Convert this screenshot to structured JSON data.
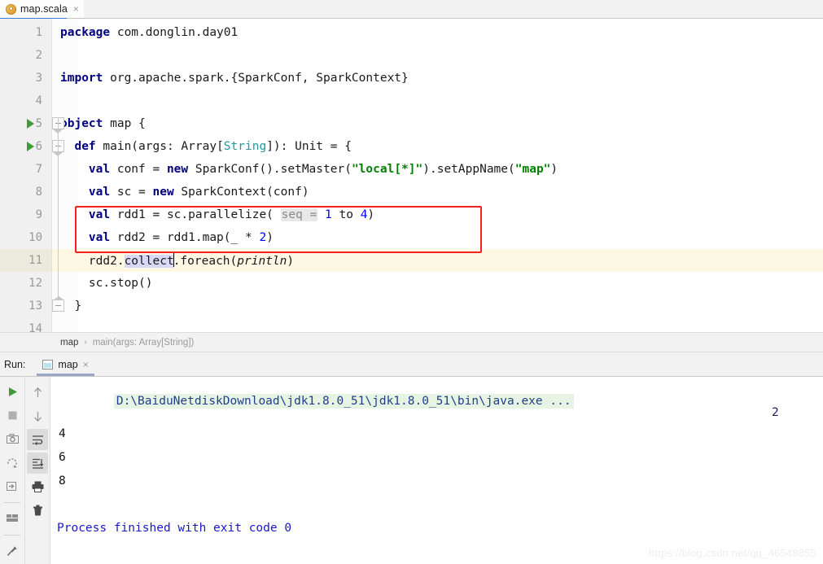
{
  "window": {
    "tab": {
      "filename": "map.scala",
      "icon": "scala-file-icon",
      "close": "×"
    }
  },
  "editor": {
    "lines": [
      {
        "n": "1",
        "segments": [
          {
            "t": "package ",
            "c": "kw"
          },
          {
            "t": "com.donglin.day01",
            "c": "plain"
          }
        ]
      },
      {
        "n": "2",
        "segments": []
      },
      {
        "n": "3",
        "segments": [
          {
            "t": "import ",
            "c": "kw"
          },
          {
            "t": "org.apache.spark.{SparkConf, SparkContext}",
            "c": "plain"
          }
        ]
      },
      {
        "n": "4",
        "segments": []
      },
      {
        "n": "5",
        "segments": [
          {
            "t": "object ",
            "c": "kw"
          },
          {
            "t": "map {",
            "c": "plain"
          }
        ]
      },
      {
        "n": "6",
        "segments": [
          {
            "t": "  def ",
            "c": "kw"
          },
          {
            "t": "main(args: Array[",
            "c": "plain"
          },
          {
            "t": "String",
            "c": "typ"
          },
          {
            "t": "]): Unit = {",
            "c": "plain"
          }
        ]
      },
      {
        "n": "7",
        "segments": [
          {
            "t": "    ",
            "c": "plain"
          },
          {
            "t": "val ",
            "c": "kw"
          },
          {
            "t": "conf = ",
            "c": "plain"
          },
          {
            "t": "new ",
            "c": "kw"
          },
          {
            "t": "SparkConf().setMaster(",
            "c": "plain"
          },
          {
            "t": "\"local[*]\"",
            "c": "str"
          },
          {
            "t": ").setAppName(",
            "c": "plain"
          },
          {
            "t": "\"map\"",
            "c": "str"
          },
          {
            "t": ")",
            "c": "plain"
          }
        ]
      },
      {
        "n": "8",
        "segments": [
          {
            "t": "    ",
            "c": "plain"
          },
          {
            "t": "val ",
            "c": "kw"
          },
          {
            "t": "sc = ",
            "c": "plain"
          },
          {
            "t": "new ",
            "c": "kw"
          },
          {
            "t": "SparkContext(conf)",
            "c": "plain"
          }
        ]
      },
      {
        "n": "9",
        "segments": [
          {
            "t": "    ",
            "c": "plain"
          },
          {
            "t": "val ",
            "c": "kw"
          },
          {
            "t": "rdd1 = sc.parallelize( ",
            "c": "plain"
          },
          {
            "t": "seq =",
            "c": "hint"
          },
          {
            "t": " ",
            "c": "plain"
          },
          {
            "t": "1",
            "c": "num"
          },
          {
            "t": " to ",
            "c": "plain"
          },
          {
            "t": "4",
            "c": "num"
          },
          {
            "t": ")",
            "c": "plain"
          }
        ]
      },
      {
        "n": "10",
        "segments": [
          {
            "t": "    ",
            "c": "plain"
          },
          {
            "t": "val ",
            "c": "kw"
          },
          {
            "t": "rdd2 = rdd1.map(_ * ",
            "c": "plain"
          },
          {
            "t": "2",
            "c": "num"
          },
          {
            "t": ")",
            "c": "plain"
          }
        ]
      },
      {
        "n": "11",
        "segments": [
          {
            "t": "    rdd2.",
            "c": "plain"
          },
          {
            "t": "collect",
            "c": "sel"
          },
          {
            "t": "",
            "c": "caret"
          },
          {
            "t": ".foreach(",
            "c": "plain"
          },
          {
            "t": "println",
            "c": "ital"
          },
          {
            "t": ")",
            "c": "plain"
          }
        ]
      },
      {
        "n": "12",
        "segments": [
          {
            "t": "    sc.stop()",
            "c": "plain"
          }
        ]
      },
      {
        "n": "13",
        "segments": [
          {
            "t": "  }",
            "c": "plain"
          }
        ]
      },
      {
        "n": "14",
        "segments": []
      }
    ],
    "current_line": "11",
    "run_arrow_lines": [
      "5",
      "6"
    ],
    "annotation": {
      "type": "red-rectangle",
      "color": "#fb1f1f",
      "covers_lines": [
        "9",
        "10"
      ]
    }
  },
  "breadcrumb": {
    "items": [
      "map",
      "main(args: Array[String])"
    ],
    "separator": "›"
  },
  "run_panel": {
    "label": "Run:",
    "tab": {
      "title": "map",
      "icon": "run-config-icon",
      "close": "×"
    },
    "left_toolbar": [
      {
        "name": "rerun-icon",
        "glyph": "▶"
      },
      {
        "name": "stop-icon",
        "glyph": "■"
      },
      {
        "name": "screenshot-icon",
        "glyph": "📷"
      },
      {
        "name": "rerun-failed-tests-icon",
        "glyph": "↻"
      },
      {
        "name": "dump-threads-icon",
        "glyph": "⇥"
      },
      {
        "name": "layout-settings-icon",
        "glyph": "▤"
      },
      {
        "name": "pin-tab-icon",
        "glyph": "📌"
      }
    ],
    "right_toolbar": [
      {
        "name": "up-arrow-icon",
        "glyph": "↑",
        "active": false
      },
      {
        "name": "down-arrow-icon",
        "glyph": "↓",
        "active": false
      },
      {
        "name": "soft-wrap-icon",
        "glyph": "↵",
        "active": true
      },
      {
        "name": "scroll-to-end-icon",
        "glyph": "↧",
        "active": true
      },
      {
        "name": "print-icon",
        "glyph": "🖨",
        "active": false
      },
      {
        "name": "clear-all-icon",
        "glyph": "🗑",
        "active": false
      }
    ],
    "console": {
      "command": "D:\\BaiduNetdiskDownload\\jdk1.8.0_51\\jdk1.8.0_51\\bin\\java.exe ...",
      "output": [
        "4",
        "6",
        "8"
      ],
      "right_value": "2",
      "finished": "Process finished with exit code 0"
    }
  },
  "watermark": "https://blog.csdn.net/qq_46548855",
  "colors": {
    "keyword": "#000080",
    "string": "#008000",
    "number": "#0000ff",
    "type": "#20999d",
    "annotation_red": "#fb1f1f",
    "tab_accent": "#3b7ddd",
    "run_arrow_green": "#3f9c35",
    "current_line_bg": "#fcf8e4",
    "console_cmd_bg": "#e8f4e3"
  }
}
